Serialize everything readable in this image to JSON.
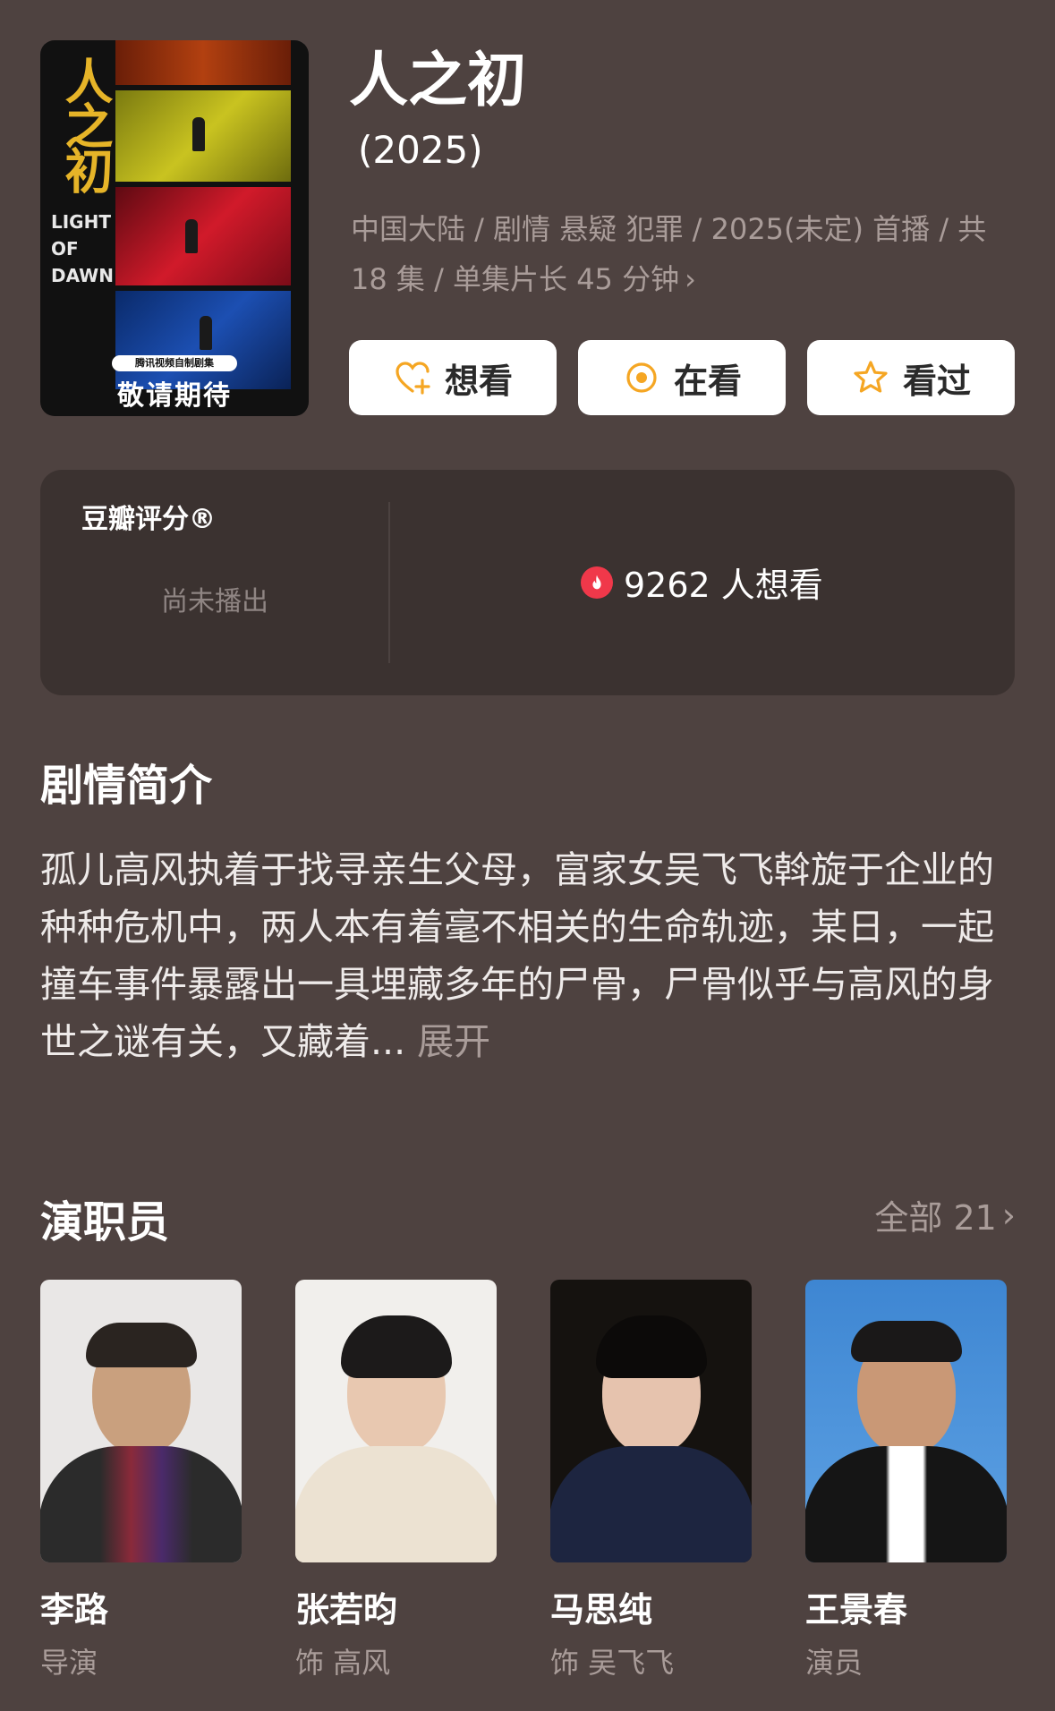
{
  "poster": {
    "title_cn": "人之初",
    "title_en": "LIGHT OF DAWN",
    "studio": "腾讯视频自制剧集",
    "tagline": "敬请期待"
  },
  "header": {
    "title": "人之初",
    "year": "(2025)",
    "meta": "中国大陆 / 剧情 悬疑 犯罪 / 2025(未定) 首播 / 共 18 集 / 单集片长 45 分钟"
  },
  "actions": [
    {
      "label": "想看",
      "icon": "heart-plus-icon"
    },
    {
      "label": "在看",
      "icon": "watching-circle-icon"
    },
    {
      "label": "看过",
      "icon": "star-icon"
    }
  ],
  "rating": {
    "label": "豆瓣评分®",
    "status": "尚未播出",
    "wish_count": "9262 人想看"
  },
  "synopsis": {
    "title": "剧情简介",
    "text": "孤儿高风执着于找寻亲生父母，富家女吴飞飞斡旋于企业的种种危机中，两人本有着毫不相关的生命轨迹，某日，一起撞车事件暴露出一具埋藏多年的尸骨，尸骨似乎与高风的身世之谜有关，又藏着...",
    "expand": "展开"
  },
  "cast": {
    "title": "演职员",
    "all_label": "全部 21",
    "members": [
      {
        "name": "李路",
        "role": "导演"
      },
      {
        "name": "张若昀",
        "role": "饰 高风"
      },
      {
        "name": "马思纯",
        "role": "饰 吴飞飞"
      },
      {
        "name": "王景春",
        "role": "演员"
      }
    ]
  },
  "colors": {
    "background": "#4e4240",
    "card": "#3b3230",
    "muted_text": "#a99c99",
    "accent_orange": "#f5a623",
    "fire_red": "#f0384a"
  }
}
